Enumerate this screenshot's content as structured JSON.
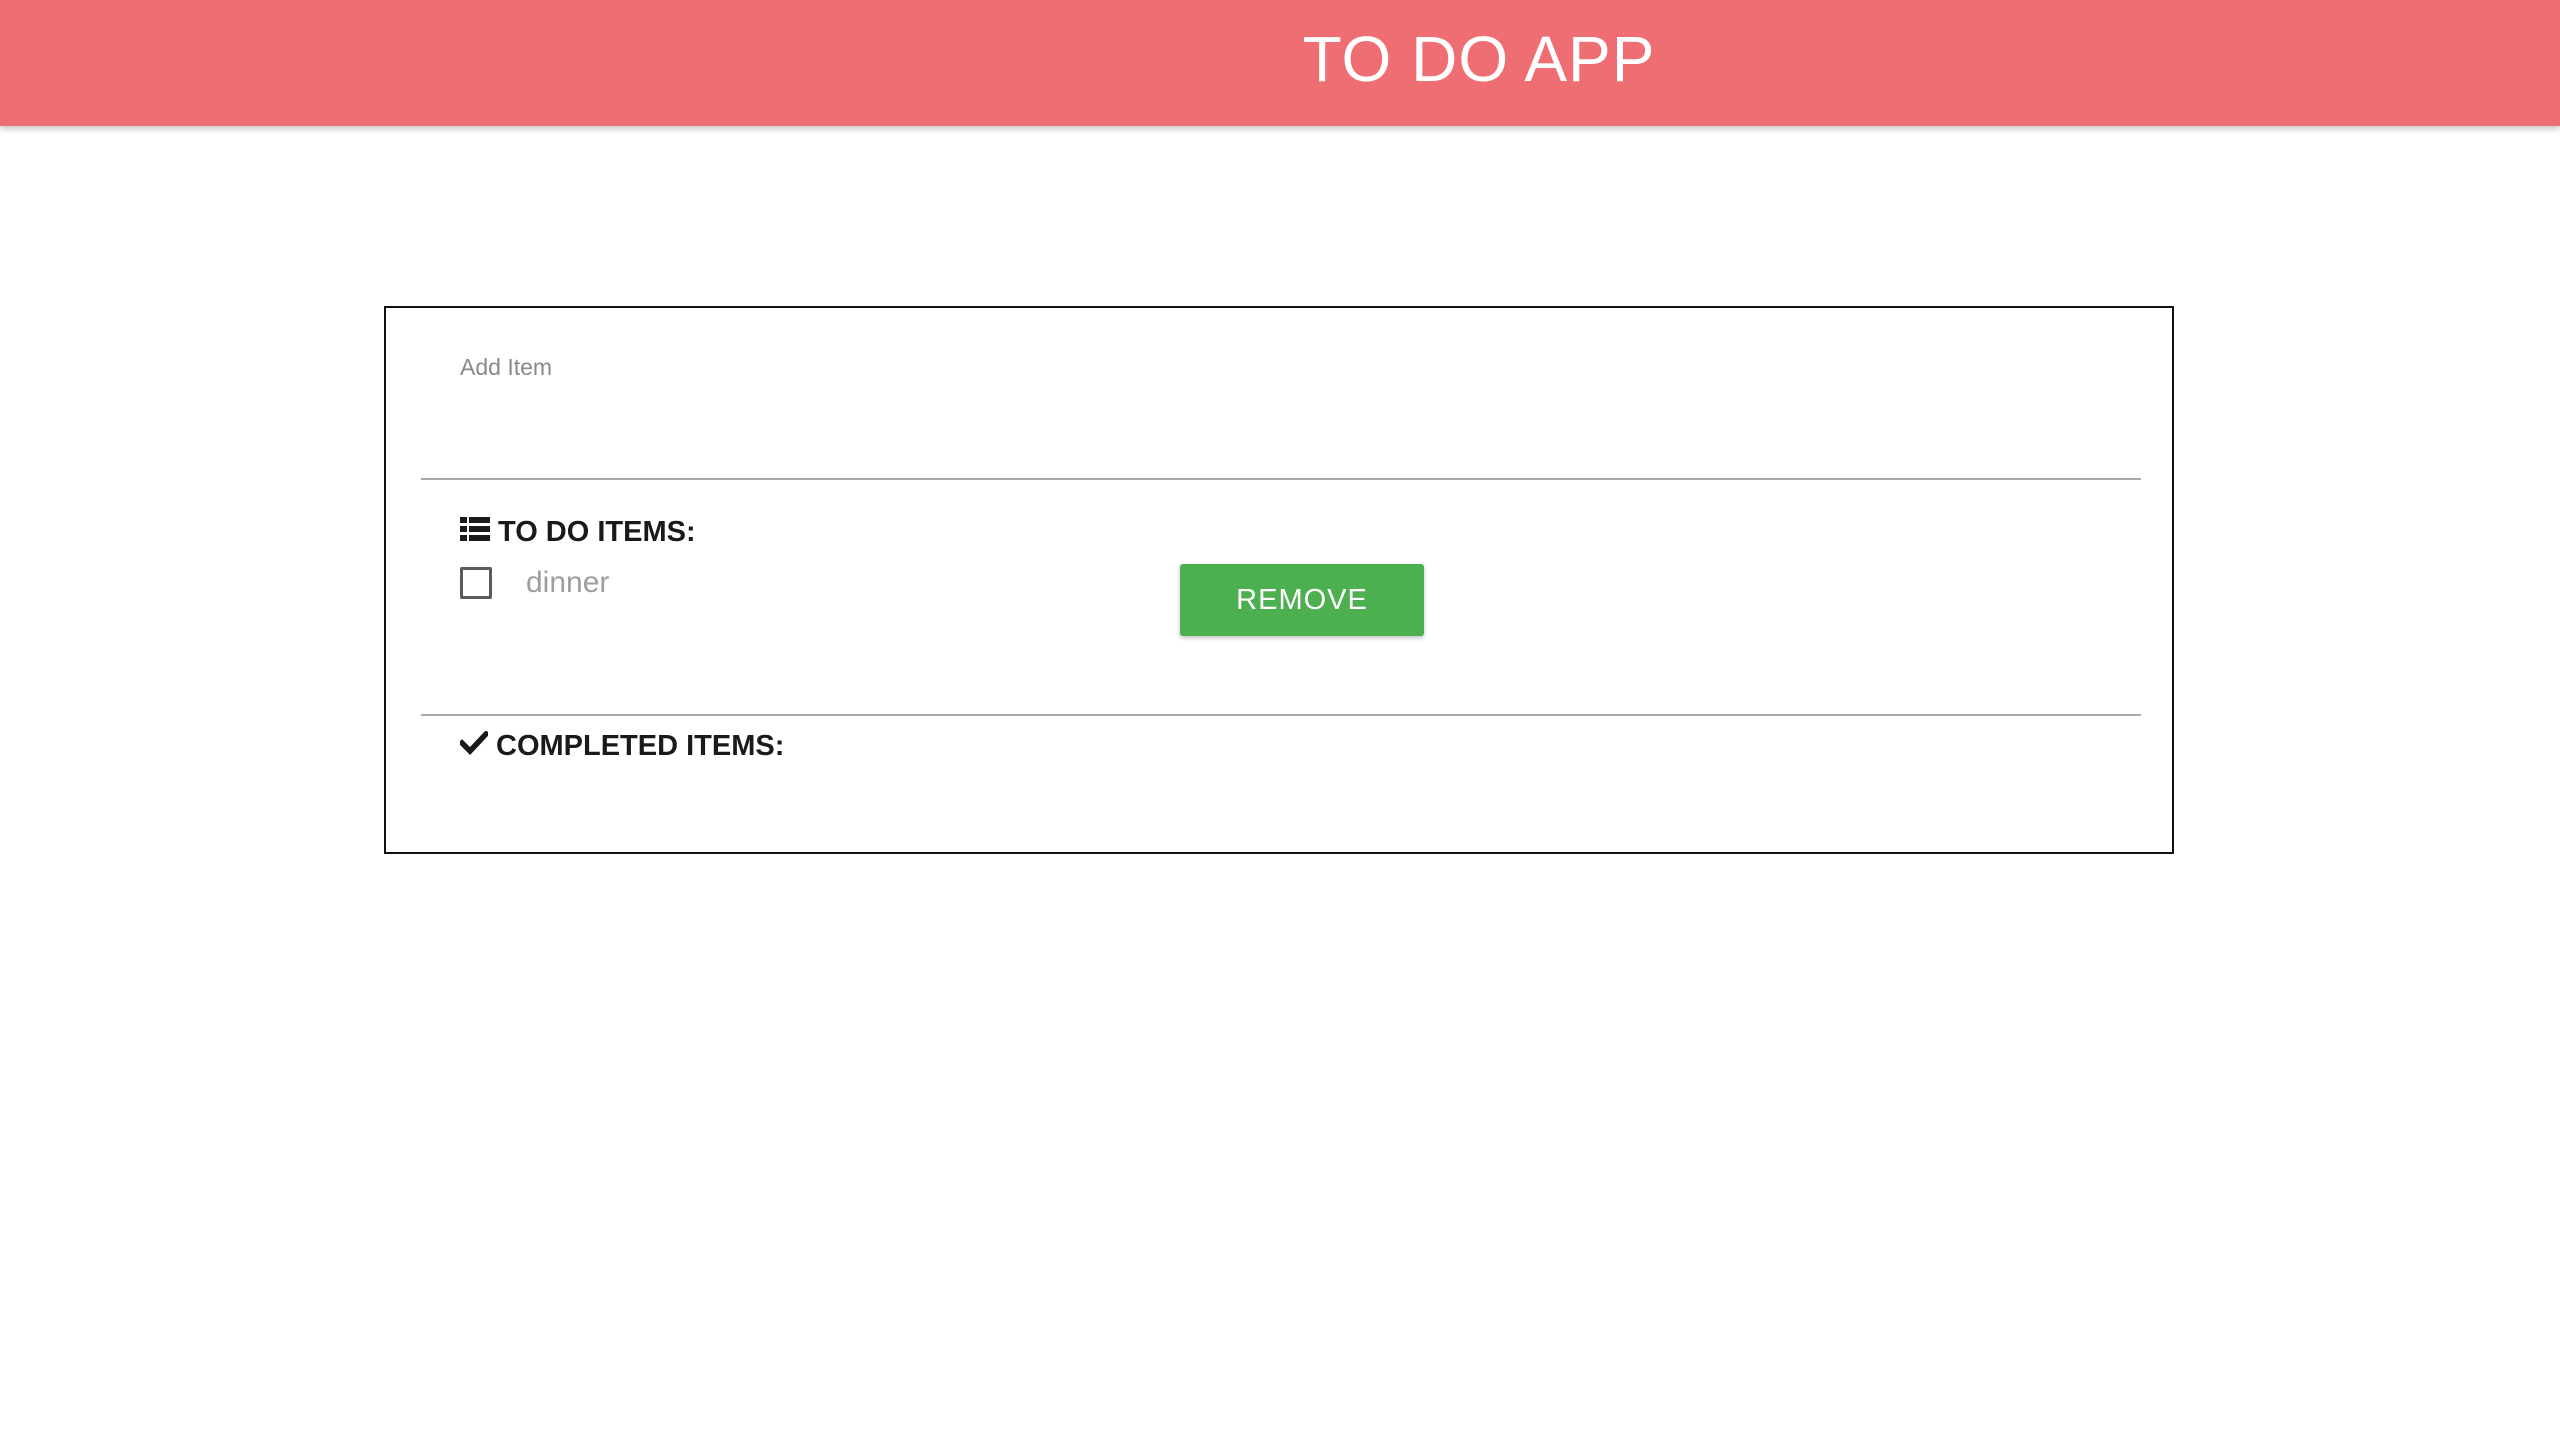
{
  "header": {
    "title": "TO DO APP",
    "background_color": "#ef6e74"
  },
  "add_item": {
    "label": "Add Item",
    "value": ""
  },
  "todo_section": {
    "heading": "TO DO ITEMS:",
    "icon": "list-icon",
    "items": [
      {
        "text": "dinner",
        "checked": false
      }
    ],
    "remove_label": "REMOVE",
    "remove_color": "#4caf50"
  },
  "completed_section": {
    "heading": "COMPLETED ITEMS:",
    "icon": "checkmark-icon",
    "items": []
  }
}
